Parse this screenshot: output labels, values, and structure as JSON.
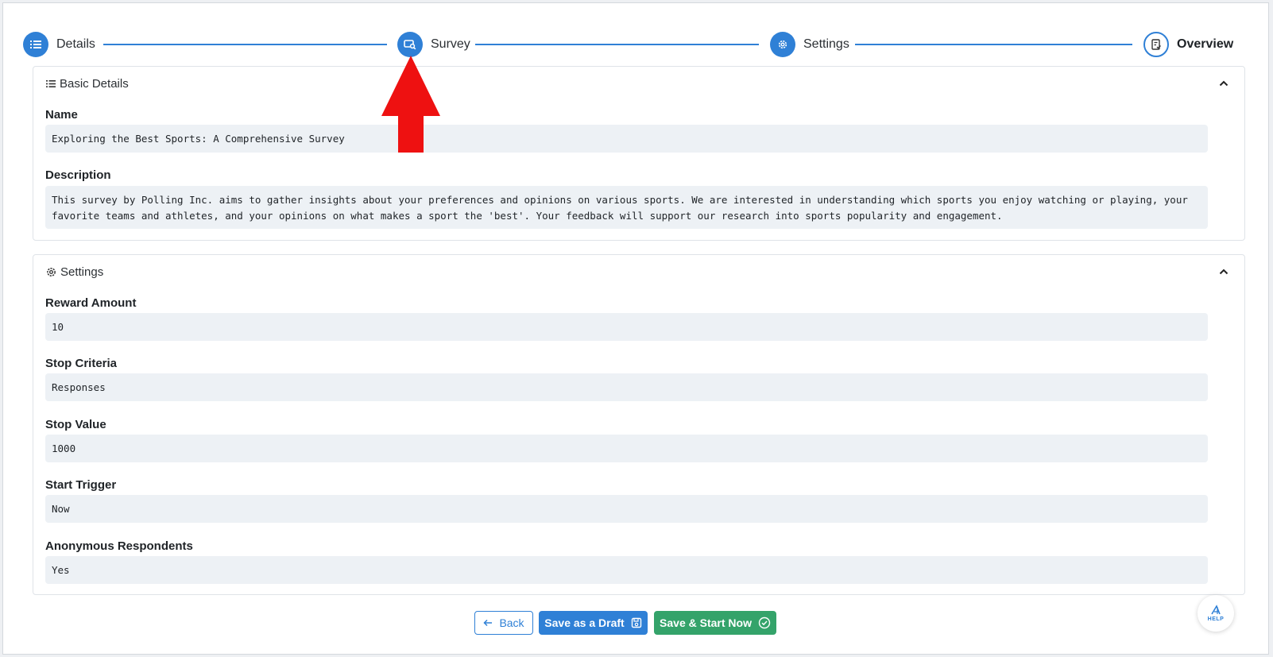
{
  "stepper": {
    "steps": [
      {
        "label": "Details",
        "icon": "list-icon"
      },
      {
        "label": "Survey",
        "icon": "survey-search-icon"
      },
      {
        "label": "Settings",
        "icon": "gear-icon"
      },
      {
        "label": "Overview",
        "icon": "clipboard-check-icon"
      }
    ],
    "accent": "#2f80d6"
  },
  "basic_details": {
    "title": "Basic Details",
    "name_label": "Name",
    "name_value": "Exploring the Best Sports: A Comprehensive Survey",
    "description_label": "Description",
    "description_value": "This survey by Polling Inc. aims to gather insights about your preferences and opinions on various sports. We are interested in understanding which sports you enjoy watching or playing, your favorite teams and athletes, and your opinions on what makes a sport the 'best'. Your feedback will support our research into sports popularity and engagement."
  },
  "settings": {
    "title": "Settings",
    "fields": [
      {
        "label": "Reward Amount",
        "value": "10"
      },
      {
        "label": "Stop Criteria",
        "value": "Responses"
      },
      {
        "label": "Stop Value",
        "value": "1000"
      },
      {
        "label": "Start Trigger",
        "value": "Now"
      },
      {
        "label": "Anonymous Respondents",
        "value": "Yes"
      }
    ]
  },
  "footer": {
    "back_label": "Back",
    "draft_label": "Save as a Draft",
    "start_label": "Save & Start Now"
  },
  "help": {
    "label": "HELP"
  },
  "annotation": {
    "color": "#ee1111",
    "icon": "red-up-arrow"
  }
}
